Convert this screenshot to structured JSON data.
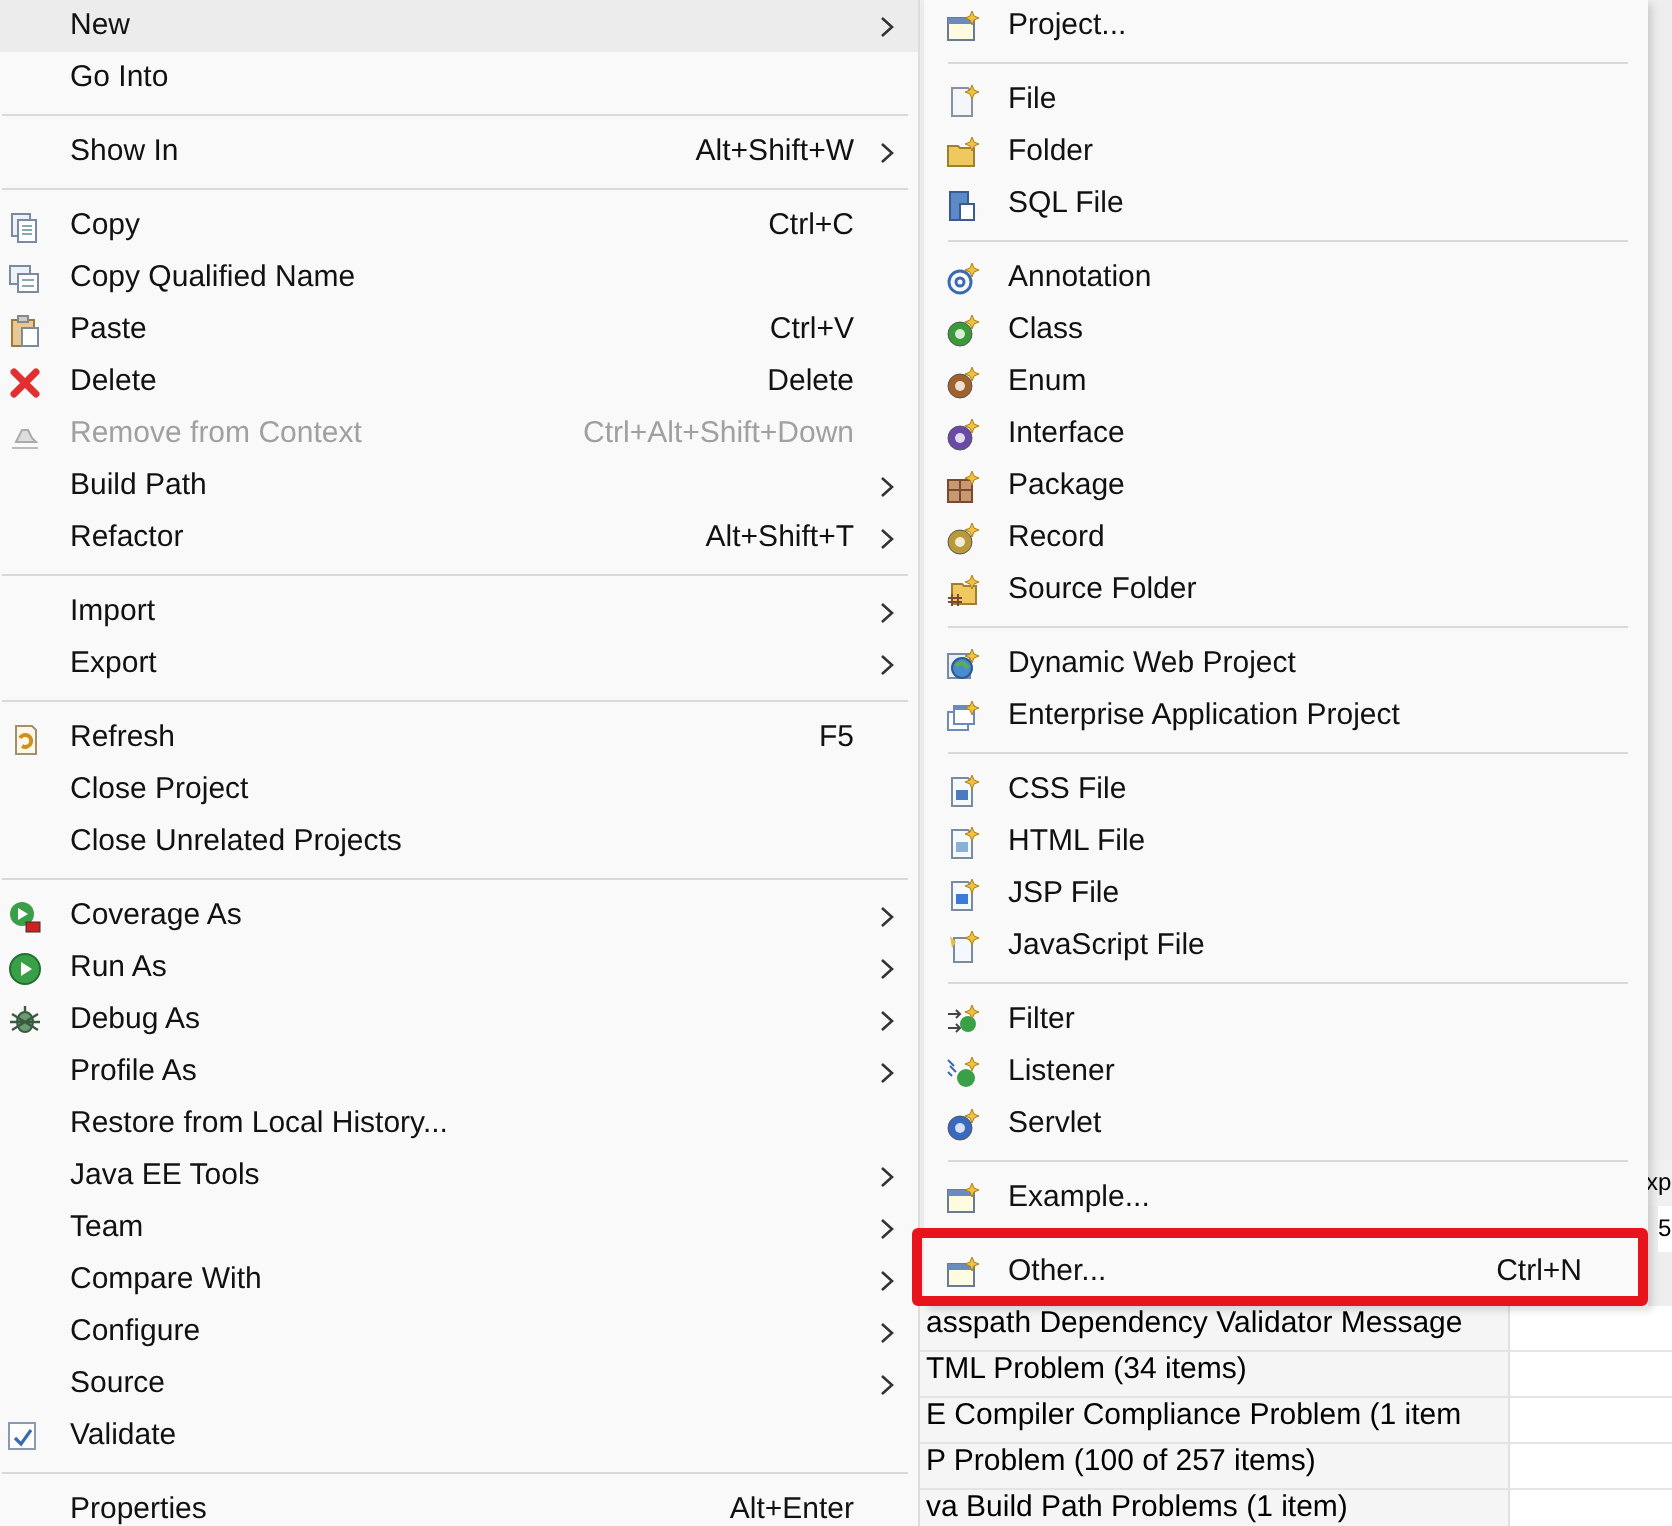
{
  "menu": {
    "groups": [
      {
        "items": [
          {
            "kind": "command",
            "label": "New",
            "highlighted": true,
            "disabled": false,
            "submenu": true
          },
          {
            "kind": "command",
            "label": "Go Into",
            "highlighted": false,
            "disabled": false,
            "submenu": false
          }
        ]
      },
      {
        "items": [
          {
            "kind": "command",
            "label": "Show In",
            "shortcut": "Alt+Shift+W",
            "highlighted": false,
            "disabled": false,
            "submenu": true
          }
        ]
      },
      {
        "items": [
          {
            "kind": "command",
            "label": "Copy",
            "shortcut": "Ctrl+C",
            "highlighted": false,
            "disabled": false,
            "submenu": false
          },
          {
            "kind": "command",
            "label": "Copy Qualified Name",
            "highlighted": false,
            "disabled": false,
            "submenu": false
          },
          {
            "kind": "command",
            "label": "Paste",
            "shortcut": "Ctrl+V",
            "highlighted": false,
            "disabled": false,
            "submenu": false
          },
          {
            "kind": "command",
            "label": "Delete",
            "shortcut": "Delete",
            "highlighted": false,
            "disabled": false,
            "submenu": false
          },
          {
            "kind": "command",
            "label": "Remove from Context",
            "shortcut": "Ctrl+Alt+Shift+Down",
            "highlighted": false,
            "disabled": true,
            "submenu": false
          },
          {
            "kind": "command",
            "label": "Build Path",
            "highlighted": false,
            "disabled": false,
            "submenu": true
          },
          {
            "kind": "command",
            "label": "Refactor",
            "shortcut": "Alt+Shift+T",
            "highlighted": false,
            "disabled": false,
            "submenu": true
          }
        ]
      },
      {
        "items": [
          {
            "kind": "command",
            "label": "Import",
            "highlighted": false,
            "disabled": false,
            "submenu": true
          },
          {
            "kind": "command",
            "label": "Export",
            "highlighted": false,
            "disabled": false,
            "submenu": true
          }
        ]
      },
      {
        "items": [
          {
            "kind": "command",
            "label": "Refresh",
            "shortcut": "F5",
            "highlighted": false,
            "disabled": false,
            "submenu": false
          },
          {
            "kind": "command",
            "label": "Close Project",
            "highlighted": false,
            "disabled": false,
            "submenu": false
          },
          {
            "kind": "command",
            "label": "Close Unrelated Projects",
            "highlighted": false,
            "disabled": false,
            "submenu": false
          }
        ]
      },
      {
        "items": [
          {
            "kind": "command",
            "label": "Coverage As",
            "highlighted": false,
            "disabled": false,
            "submenu": true
          },
          {
            "kind": "command",
            "label": "Run As",
            "highlighted": false,
            "disabled": false,
            "submenu": true
          },
          {
            "kind": "command",
            "label": "Debug As",
            "highlighted": false,
            "disabled": false,
            "submenu": true
          },
          {
            "kind": "command",
            "label": "Profile As",
            "highlighted": false,
            "disabled": false,
            "submenu": true
          },
          {
            "kind": "command",
            "label": "Restore from Local History...",
            "highlighted": false,
            "disabled": false,
            "submenu": false
          },
          {
            "kind": "command",
            "label": "Java EE Tools",
            "highlighted": false,
            "disabled": false,
            "submenu": true
          },
          {
            "kind": "command",
            "label": "Team",
            "highlighted": false,
            "disabled": false,
            "submenu": true
          },
          {
            "kind": "command",
            "label": "Compare With",
            "highlighted": false,
            "disabled": false,
            "submenu": true
          },
          {
            "kind": "command",
            "label": "Configure",
            "highlighted": false,
            "disabled": false,
            "submenu": true
          },
          {
            "kind": "command",
            "label": "Source",
            "highlighted": false,
            "disabled": false,
            "submenu": true
          },
          {
            "kind": "check",
            "label": "Validate",
            "checked": true,
            "highlighted": false,
            "disabled": false,
            "submenu": false
          }
        ]
      },
      {
        "items": [
          {
            "kind": "command",
            "label": "Properties",
            "shortcut": "Alt+Enter",
            "highlighted": false,
            "disabled": false,
            "submenu": false
          }
        ]
      }
    ]
  },
  "submenu": {
    "groups": [
      {
        "items": [
          {
            "label": "Project...",
            "marked": false
          }
        ]
      },
      {
        "items": [
          {
            "label": "File",
            "marked": false
          },
          {
            "label": "Folder",
            "marked": false
          },
          {
            "label": "SQL File",
            "marked": false
          }
        ]
      },
      {
        "items": [
          {
            "label": "Annotation",
            "marked": false
          },
          {
            "label": "Class",
            "marked": false
          },
          {
            "label": "Enum",
            "marked": false
          },
          {
            "label": "Interface",
            "marked": false
          },
          {
            "label": "Package",
            "marked": false
          },
          {
            "label": "Record",
            "marked": false
          },
          {
            "label": "Source Folder",
            "marked": false
          }
        ]
      },
      {
        "items": [
          {
            "label": "Dynamic Web Project",
            "marked": false
          },
          {
            "label": "Enterprise Application Project",
            "marked": false
          }
        ]
      },
      {
        "items": [
          {
            "label": "CSS File",
            "marked": false
          },
          {
            "label": "HTML File",
            "marked": false
          },
          {
            "label": "JSP File",
            "marked": false
          },
          {
            "label": "JavaScript File",
            "marked": false
          }
        ]
      },
      {
        "items": [
          {
            "label": "Filter",
            "marked": false
          },
          {
            "label": "Listener",
            "marked": false
          },
          {
            "label": "Servlet",
            "marked": false
          }
        ]
      },
      {
        "items": [
          {
            "label": "Example...",
            "marked": false
          }
        ]
      },
      {
        "items": [
          {
            "label": "Other...",
            "shortcut": "Ctrl+N",
            "marked": true
          }
        ]
      }
    ]
  },
  "background": {
    "column_header": "xp",
    "column_value": "5",
    "table": {
      "rows": [
        "asspath Dependency Validator Message",
        "TML Problem (34 items)",
        "E Compiler Compliance Problem (1 item",
        "P Problem (100 of 257 items)",
        "va Build Path Problems (1 item)"
      ]
    }
  }
}
